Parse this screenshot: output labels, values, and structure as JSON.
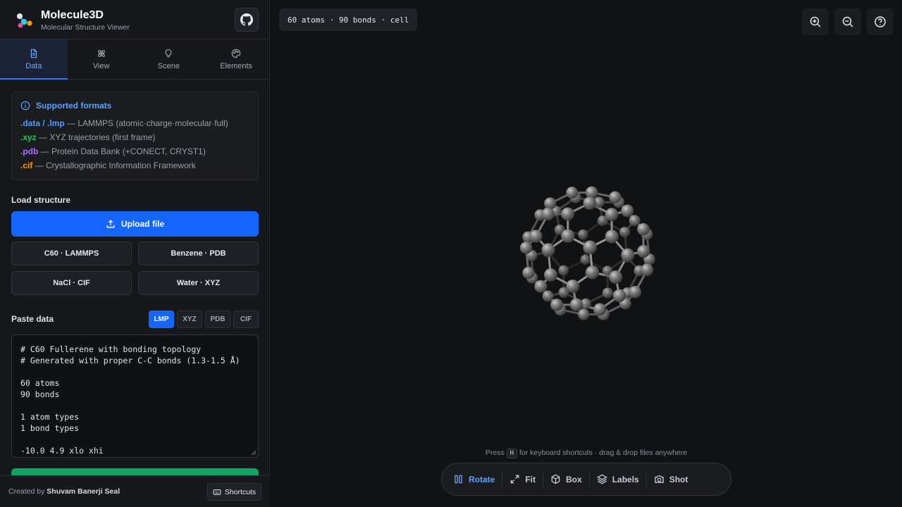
{
  "app": {
    "title": "Molecule3D",
    "subtitle": "Molecular Structure Viewer"
  },
  "tabs": [
    {
      "label": "Data",
      "icon": "document-icon",
      "active": true
    },
    {
      "label": "View",
      "icon": "atom-icon",
      "active": false
    },
    {
      "label": "Scene",
      "icon": "lightbulb-icon",
      "active": false
    },
    {
      "label": "Elements",
      "icon": "palette-icon",
      "active": false
    }
  ],
  "formats": {
    "title": "Supported formats",
    "items": [
      {
        "ext": ".data / .lmp",
        "desc": " — LAMMPS (atomic·charge·molecular·full)",
        "color": "#4f9bff"
      },
      {
        "ext": ".xyz",
        "desc": " — XYZ trajectories (first frame)",
        "color": "#22c55e"
      },
      {
        "ext": ".pdb",
        "desc": " — Protein Data Bank (+CONECT, CRYST1)",
        "color": "#b06cff"
      },
      {
        "ext": ".cif",
        "desc": " — Crystallographic Information Framework",
        "color": "#f59e0b"
      }
    ]
  },
  "load": {
    "label": "Load structure",
    "upload_label": "Upload file",
    "samples": [
      "C60 · LAMMPS",
      "Benzene · PDB",
      "NaCl · CIF",
      "Water · XYZ"
    ]
  },
  "paste": {
    "label": "Paste data",
    "formats": [
      "LMP",
      "XYZ",
      "PDB",
      "CIF"
    ],
    "selected_format": "LMP",
    "content": "# C60 Fullerene with bonding topology\n# Generated with proper C-C bonds (1.3-1.5 Å)\n\n60 atoms\n90 bonds\n\n1 atom types\n1 bond types\n\n-10.0 4.9 xlo xhi"
  },
  "footer": {
    "credit_prefix": "Created by ",
    "credit_name": "Shuvam Banerji Seal",
    "shortcuts_label": "Shortcuts"
  },
  "viewport": {
    "info": "60 atoms · 90 bonds · cell",
    "hint_prefix": "Press ",
    "hint_key": "H",
    "hint_suffix": " for keyboard shortcuts · drag & drop files anywhere",
    "toolbar": [
      {
        "label": "Rotate",
        "icon": "pause-icon",
        "active": true
      },
      {
        "label": "Fit",
        "icon": "expand-icon",
        "active": false
      },
      {
        "label": "Box",
        "icon": "cube-icon",
        "active": false
      },
      {
        "label": "Labels",
        "icon": "layers-icon",
        "active": false
      },
      {
        "label": "Shot",
        "icon": "camera-icon",
        "active": false
      }
    ]
  },
  "colors": {
    "accent": "#1566ff",
    "accent_text": "#5ea2ff",
    "parse_button": "#12a363",
    "atom": "#8a8a8a"
  }
}
